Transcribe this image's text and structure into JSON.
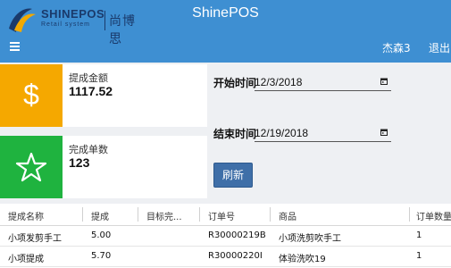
{
  "header": {
    "app_title": "ShinePOS",
    "logo_name": "SHINEPOS",
    "logo_sub": "Retail system",
    "logo_cn": "尚博思",
    "user": "杰森3",
    "logout": "退出",
    "background_color": "#3e8fd2"
  },
  "cards": [
    {
      "label": "提成金额",
      "value": "1117.52",
      "icon": "dollar-icon",
      "color": "#f5a800"
    },
    {
      "label": "完成单数",
      "value": "123",
      "icon": "star-icon",
      "color": "#1fb33f"
    }
  ],
  "filters": {
    "start_label": "开始时间",
    "start_value": "12/3/2018",
    "end_label": "结束时间",
    "end_value": "12/19/2018",
    "refresh_label": "刷新"
  },
  "table": {
    "columns": [
      "提成名称",
      "提成",
      "目标完...",
      "订单号",
      "商品",
      "订单数量"
    ],
    "rows": [
      [
        "小项发剪手工",
        "5.00",
        "",
        "R30000219B",
        "小项洗剪吹手工",
        "1"
      ],
      [
        "小项提成",
        "5.70",
        "",
        "R30000220I",
        "体验洗吹19",
        "1"
      ]
    ]
  }
}
